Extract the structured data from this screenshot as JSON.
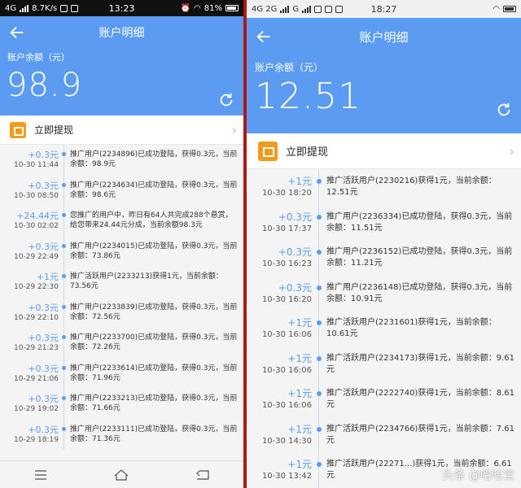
{
  "left": {
    "status": {
      "network": "4G",
      "speed": "8.7K/s",
      "time": "13:23",
      "battery": "81%"
    },
    "title": "账户明细",
    "balance_label": "账户余额（元）",
    "balance": "98.9",
    "withdraw_label": "立即提现",
    "records": [
      {
        "amount": "+0.3元",
        "time": "10-30 11:44",
        "desc": "推广用户(2234896)已成功登陆，获得0.3元，当前余额：98.9元"
      },
      {
        "amount": "+0.3元",
        "time": "10-30 08:50",
        "desc": "推广用户(2234634)已成功登陆，获得0.3元，当前余额：98.6元"
      },
      {
        "amount": "+24.44元",
        "time": "10-30 02:02",
        "desc": "您推广的用户中，昨日有64人共完成288个悬赏，给您带来24.44元分成，当前余额98.3元"
      },
      {
        "amount": "+0.3元",
        "time": "10-29 22:49",
        "desc": "推广用户(2234015)已成功登陆，获得0.3元，当前余额：73.86元"
      },
      {
        "amount": "+1元",
        "time": "10-29 22:30",
        "desc": "推广活跃用户(2233213)获得1元，当前余额：73.56元"
      },
      {
        "amount": "+0.3元",
        "time": "10-29 22:10",
        "desc": "推广用户(2233839)已成功登陆，获得0.3元，当前余额：72.56元"
      },
      {
        "amount": "+0.3元",
        "time": "10-29 21:23",
        "desc": "推广用户(2233700)已成功登陆，获得0.3元，当前余额：72.26元"
      },
      {
        "amount": "+0.3元",
        "time": "10-29 21:06",
        "desc": "推广用户(2233614)已成功登陆，获得0.3元，当前余额：71.96元"
      },
      {
        "amount": "+0.3元",
        "time": "10-29 19:02",
        "desc": "推广用户(2233213)已成功登陆，获得0.3元，当前余额：71.66元"
      },
      {
        "amount": "+0.3元",
        "time": "10-29 18:19",
        "desc": "推广用户(2233111)已成功登陆，获得0.3元，当前余额：71.36元"
      }
    ]
  },
  "right": {
    "status": {
      "network": "4G 2G",
      "signal": "G",
      "time": "18:27"
    },
    "title": "账户明细",
    "balance_label": "账户余额（元）",
    "balance": "12.51",
    "withdraw_label": "立即提现",
    "records": [
      {
        "amount": "+1元",
        "time": "10-30 18:20",
        "desc": "推广活跃用户(2230216)获得1元，当前余额：12.51元"
      },
      {
        "amount": "+0.3元",
        "time": "10-30 17:37",
        "desc": "推广用户(2236334)已成功登陆，获得0.3元，当前余额：11.51元"
      },
      {
        "amount": "+0.3元",
        "time": "10-30 16:23",
        "desc": "推广用户(2236152)已成功登陆，获得0.3元，当前余额：11.21元"
      },
      {
        "amount": "+0.3元",
        "time": "10-30 16:20",
        "desc": "推广用户(2236148)已成功登陆，获得0.3元，当前余额：10.91元"
      },
      {
        "amount": "+1元",
        "time": "10-30 16:06",
        "desc": "推广活跃用户(2231601)获得1元，当前余额：10.61元"
      },
      {
        "amount": "+1元",
        "time": "10-30 16:06",
        "desc": "推广活跃用户(2234173)获得1元，当前余额：9.61元"
      },
      {
        "amount": "+1元",
        "time": "10-30 16:06",
        "desc": "推广活跃用户(2222740)获得1元，当前余额：8.61元"
      },
      {
        "amount": "+1元",
        "time": "10-30 14:30",
        "desc": "推广活跃用户(2234766)获得1元，当前余额：7.61元"
      },
      {
        "amount": "+1元",
        "time": "10-30 13:42",
        "desc": "推广活跃用户(22271...)获得1元，当前余额：6.61元"
      }
    ]
  },
  "watermark": "头条 @哈哈宝"
}
